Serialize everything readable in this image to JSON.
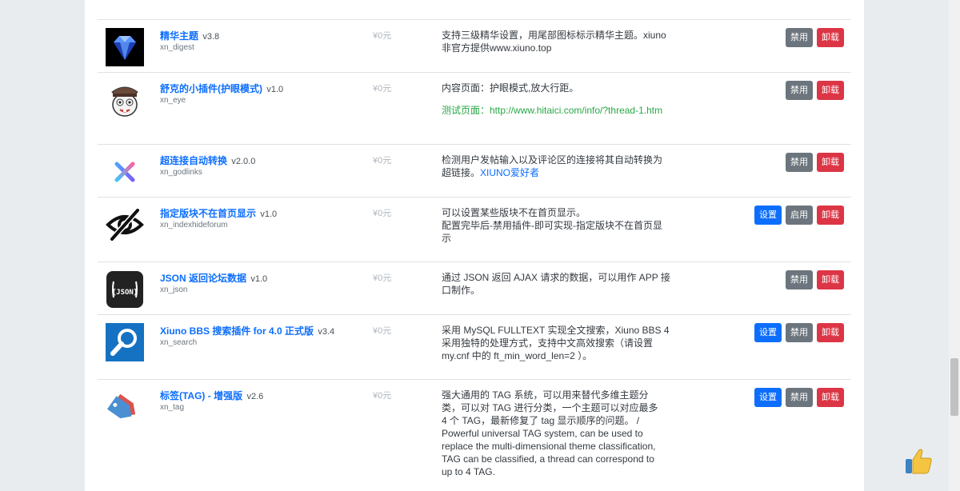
{
  "prices": "¥0元",
  "buttons": {
    "setting": "设置",
    "disable": "禁用",
    "enable": "启用",
    "uninstall": "卸载"
  },
  "plugins": [
    {
      "name": "精华主题",
      "version": "v3.8",
      "dir": "xn_digest",
      "desc": "支持三级精华设置，用尾部图标标示精华主题。xiuno非官方提供www.xiuno.top",
      "buttons": [
        "disable",
        "uninstall"
      ]
    },
    {
      "name": "舒克的小插件(护眼模式)",
      "version": "v1.0",
      "dir": "xn_eye",
      "desc": "内容页面：护眼模式,放大行距。",
      "desc_link": "测试页面：http://www.hitaici.com/info/?thread-1.htm",
      "buttons": [
        "disable",
        "uninstall"
      ]
    },
    {
      "name": "超连接自动转换",
      "version": "v2.0.0",
      "dir": "xn_godlinks",
      "desc": "检测用户发帖输入以及评论区的连接将其自动转换为超链接。",
      "desc_tail": "XIUNO爱好者",
      "buttons": [
        "disable",
        "uninstall"
      ]
    },
    {
      "name": "指定版块不在首页显示",
      "version": "v1.0",
      "dir": "xn_indexhideforum",
      "desc": "可以设置某些版块不在首页显示。",
      "desc_line2": "配置完毕后-禁用插件-即可实现-指定版块不在首页显示",
      "buttons": [
        "setting",
        "enable",
        "uninstall"
      ]
    },
    {
      "name": "JSON 返回论坛数据",
      "version": "v1.0",
      "dir": "xn_json",
      "desc": "通过 JSON 返回 AJAX 请求的数据，可以用作 APP 接口制作。",
      "buttons": [
        "disable",
        "uninstall"
      ]
    },
    {
      "name": "Xiuno BBS 搜索插件 for 4.0 正式版",
      "version": "v3.4",
      "dir": "xn_search",
      "desc": "采用 MySQL FULLTEXT 实现全文搜索，Xiuno BBS 4 采用独特的处理方式，支持中文高效搜索（请设置 my.cnf 中的 ft_min_word_len=2 ）。",
      "buttons": [
        "setting",
        "disable",
        "uninstall"
      ]
    },
    {
      "name": "标签(TAG) - 增强版",
      "version": "v2.6",
      "dir": "xn_tag",
      "desc": "强大通用的 TAG 系统，可以用来替代多维主题分类，可以对 TAG 进行分类，一个主题可以对应最多 4 个 TAG，最新修复了 tag 显示顺序的问题。 / Powerful universal TAG system, can be used to replace the multi-dimensional theme classification, TAG can be classified, a thread can correspond to up to 4 TAG.",
      "buttons": [
        "setting",
        "disable",
        "uninstall"
      ]
    }
  ],
  "icons": [
    "diamond-icon",
    "bunny-mascot-icon",
    "x-logo-icon",
    "hidden-eye-icon",
    "json-icon",
    "search-magnifier-icon",
    "tag-icon",
    "thumbs-up-icon"
  ]
}
